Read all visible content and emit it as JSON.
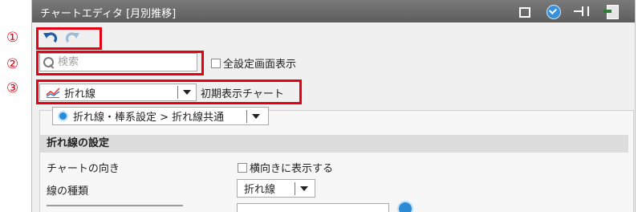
{
  "callouts": [
    "①",
    "②",
    "③"
  ],
  "window": {
    "title": "チャートエディタ [月別推移]"
  },
  "titlebar_icons": [
    "window-icon",
    "help-check-icon",
    "pin-icon",
    "exit-icon"
  ],
  "toolbar": {
    "undo_icon": "undo-icon",
    "redo_icon": "redo-icon"
  },
  "search": {
    "placeholder": "検索",
    "value": ""
  },
  "all_settings": {
    "label": "全設定画面表示",
    "checked": false
  },
  "chart_type": {
    "value": "折れ線",
    "initial_label": "初期表示チャート"
  },
  "breadcrumb": {
    "value": "折れ線・棒系設定 > 折れ線共通"
  },
  "section": {
    "title": "折れ線の設定",
    "rows": [
      {
        "label": "チャートの向き",
        "option_label": "横向きに表示する",
        "checked": false
      },
      {
        "label": "線の種類",
        "select_value": "折れ線"
      }
    ]
  },
  "colors": {
    "highlight": "#e60012",
    "titlebar": "#6a6a6a",
    "accent_blue": "#2d8ad6"
  }
}
